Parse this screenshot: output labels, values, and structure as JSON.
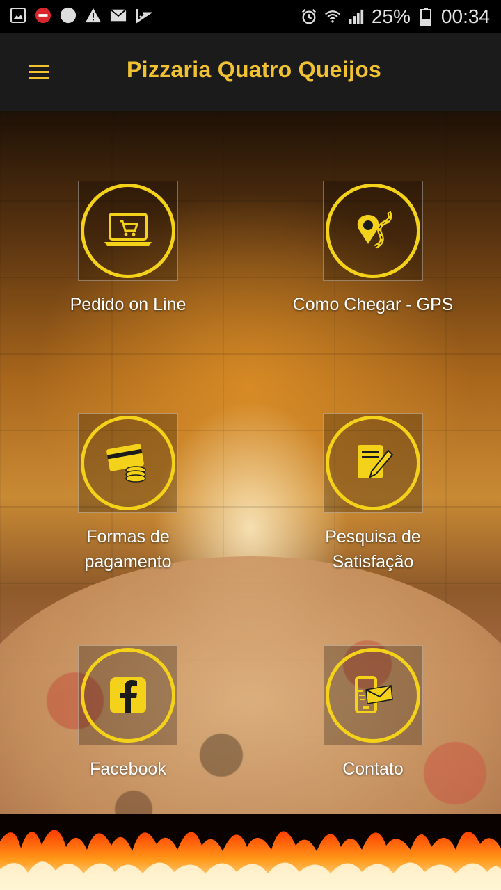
{
  "statusbar": {
    "battery": "25%",
    "time": "00:34",
    "icons_left": [
      "image-icon",
      "do-not-disturb-icon",
      "circle-icon",
      "warning-icon",
      "mail-icon",
      "check-icon"
    ],
    "icons_right": [
      "alarm-icon",
      "wifi-icon",
      "signal-icon",
      "battery-icon"
    ]
  },
  "toolbar": {
    "title": "Pizzaria Quatro Queijos",
    "menu_icon": "hamburger-menu-icon"
  },
  "menu": {
    "items": [
      {
        "label": "Pedido on Line",
        "icon": "laptop-cart-icon"
      },
      {
        "label": "Como Chegar - GPS",
        "icon": "map-pin-road-icon"
      },
      {
        "label": "Formas de\npagamento",
        "icon": "credit-card-coins-icon"
      },
      {
        "label": "Pesquisa de\nSatisfação",
        "icon": "clipboard-pen-icon"
      },
      {
        "label": "Facebook",
        "icon": "facebook-icon"
      },
      {
        "label": "Contato",
        "icon": "phone-envelope-icon"
      }
    ]
  },
  "colors": {
    "accent": "#f5d21a",
    "title": "#f0c232",
    "toolbar_bg": "#1b1b1b",
    "statusbar_bg": "#000000"
  }
}
